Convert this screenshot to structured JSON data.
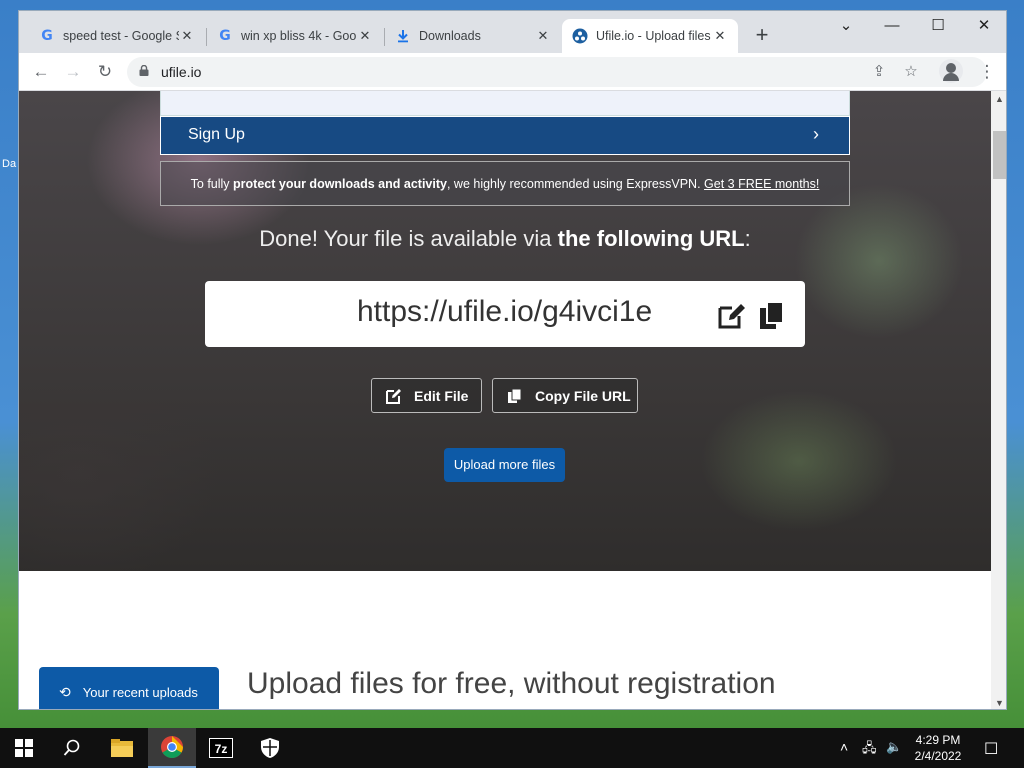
{
  "desktop": {
    "edge_label": "Da"
  },
  "browser": {
    "tabs": [
      {
        "label": "speed test - Google S",
        "icon": "google-icon",
        "active": false
      },
      {
        "label": "win xp bliss 4k - Goo",
        "icon": "google-icon",
        "active": false
      },
      {
        "label": "Downloads",
        "icon": "download-icon",
        "active": false
      },
      {
        "label": "Ufile.io - Upload files",
        "icon": "ufile-icon",
        "active": true
      }
    ],
    "new_tab": "+",
    "window_controls": {
      "dropdown": "⌄",
      "minimize": "—",
      "maximize": "☐",
      "close": "✕"
    },
    "address": "ufile.io"
  },
  "page": {
    "signup_label": "Sign Up",
    "vpn_notice": {
      "prefix": "To fully ",
      "bold": "protect your downloads and activity",
      "middle": ", we highly recommended using ExpressVPN. ",
      "link": "Get 3 FREE months!"
    },
    "done_prefix": "Done! Your file is available via ",
    "done_bold": "the following URL",
    "done_suffix": ":",
    "file_url": "https://ufile.io/g4ivci1e",
    "edit_file_label": "Edit File",
    "copy_url_label": "Copy File URL",
    "upload_more_label": "Upload more files",
    "recent_uploads_label": "Your recent uploads",
    "section_title": "Upload files for free, without registration"
  },
  "taskbar": {
    "items": [
      "start-icon",
      "search-icon",
      "file-explorer-icon",
      "chrome-icon",
      "7zip-icon",
      "security-icon"
    ],
    "clock_time": "4:29 PM",
    "clock_date": "2/4/2022"
  }
}
